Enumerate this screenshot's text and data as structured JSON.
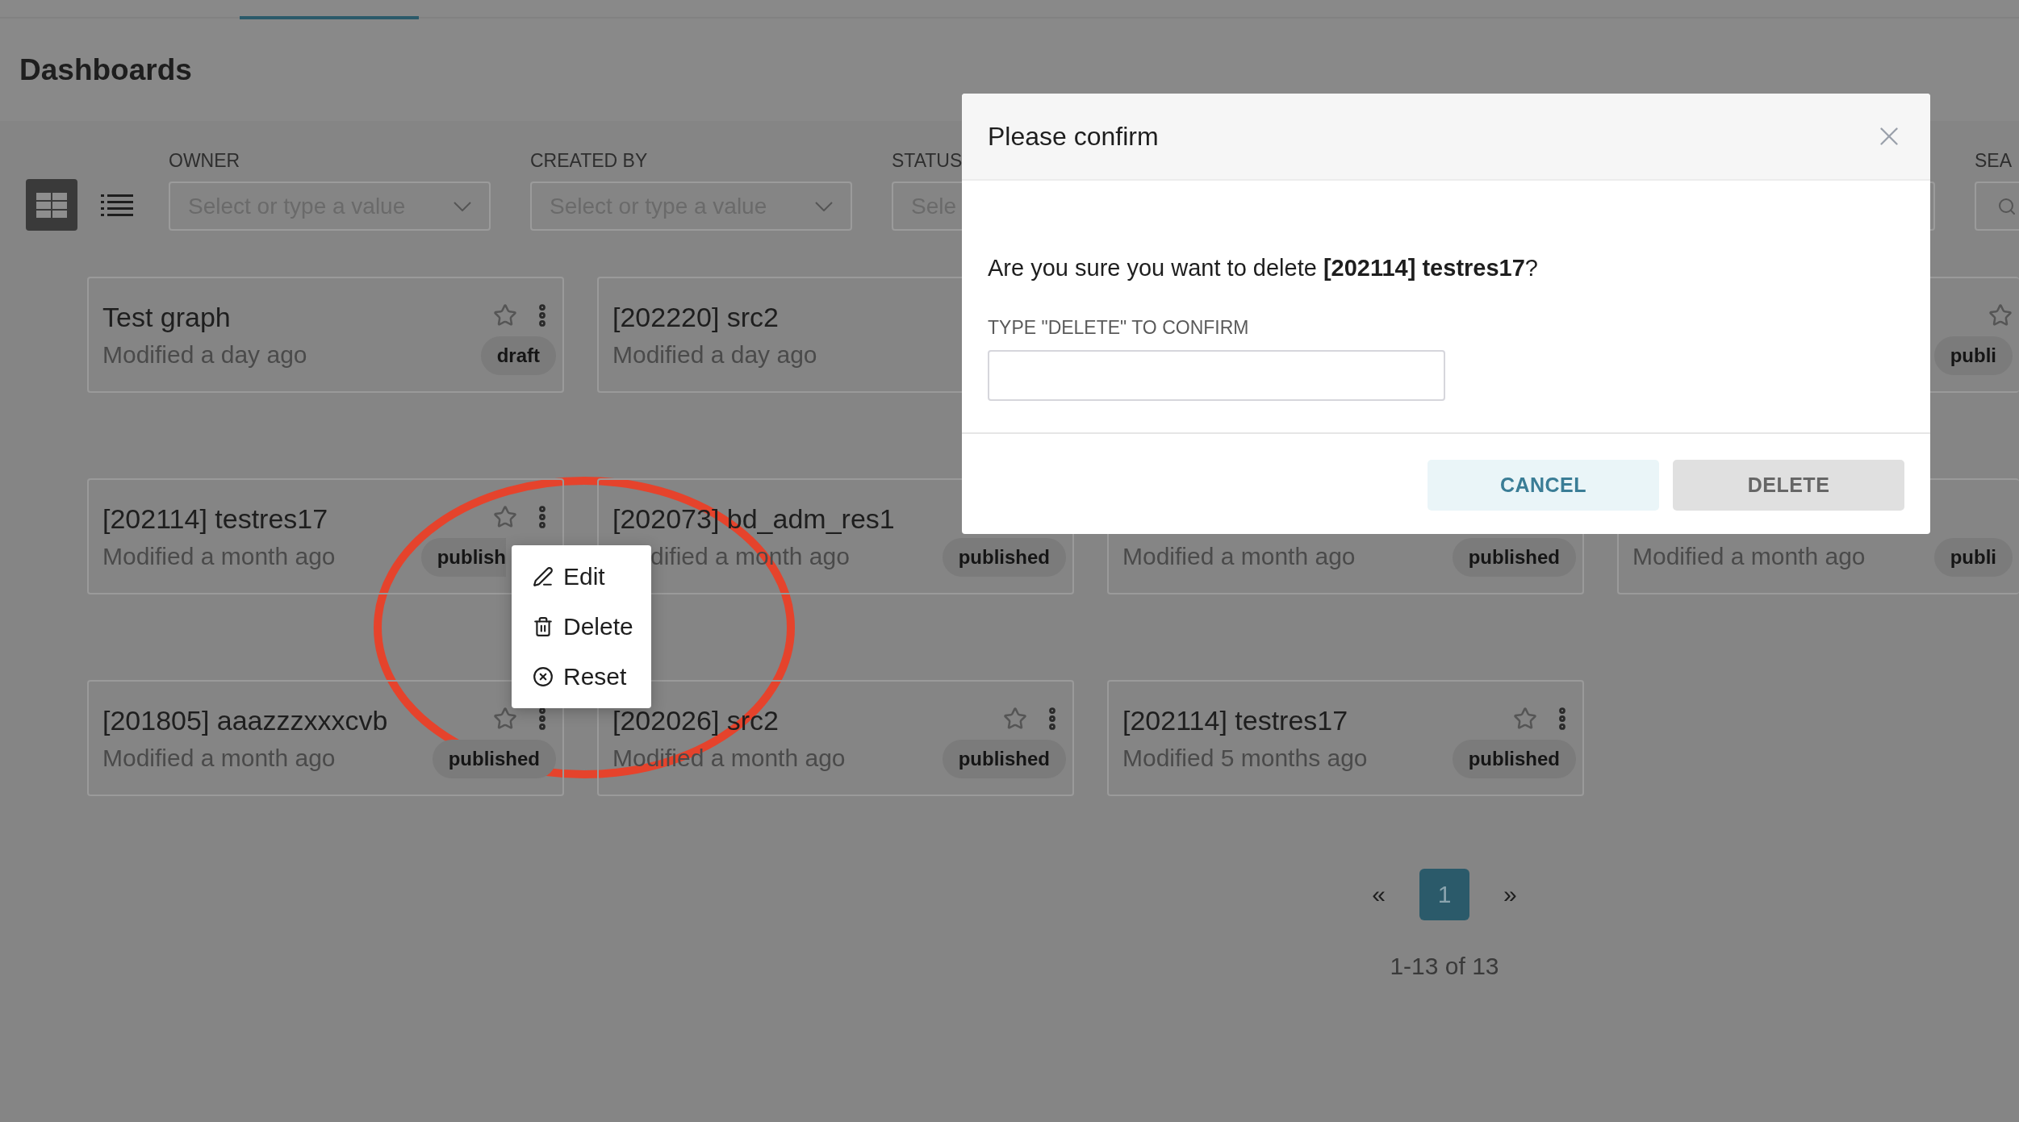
{
  "page": {
    "title": "Dashboards"
  },
  "views": [
    {
      "kind": "grid",
      "selected": true
    },
    {
      "kind": "list",
      "selected": false
    }
  ],
  "filters": [
    {
      "label": "OWNER",
      "placeholder": "Select or type a value",
      "kind": "select"
    },
    {
      "label": "CREATED BY",
      "placeholder": "Select or type a value",
      "kind": "select"
    },
    {
      "label": "STATUS",
      "placeholder": "Sele",
      "kind": "wide"
    }
  ],
  "search": {
    "label": "SEA"
  },
  "card_rows": [
    [
      {
        "kind": "full",
        "title": "Test graph",
        "subtitle": "Modified a day ago",
        "status": "draft"
      },
      {
        "kind": "plain",
        "title": "[202220] src2",
        "subtitle": "Modified a day ago"
      },
      {
        "kind": "blank"
      },
      {
        "kind": "edge",
        "status": "publi"
      }
    ],
    [
      {
        "kind": "menu-open",
        "title": "[202114] testres17",
        "subtitle": "Modified a month ago",
        "status": "publish"
      },
      {
        "kind": "under-menu",
        "title": "[202073] bd_adm_res1",
        "subtitle": "dified a month ago",
        "status": "published"
      },
      {
        "kind": "lower",
        "subtitle": "Modified a month ago",
        "status": "published"
      },
      {
        "kind": "lower",
        "subtitle": "Modified a month ago",
        "status": "publi"
      }
    ],
    [
      {
        "kind": "full",
        "title": "[201805] aaazzzxxxcvb",
        "subtitle": "Modified a month ago",
        "status": "published"
      },
      {
        "kind": "full",
        "title": "[202026] src2",
        "subtitle": "Modified a month ago",
        "status": "published"
      },
      {
        "kind": "full",
        "title": "[202114] testres17",
        "subtitle": "Modified 5 months ago",
        "status": "published"
      }
    ]
  ],
  "pagination": {
    "prev": "«",
    "pages": [
      {
        "label": "1",
        "selected": true
      }
    ],
    "next": "»",
    "summary": "1-13 of 13"
  },
  "context_menu": {
    "items": [
      {
        "kind": "edit",
        "label": "Edit"
      },
      {
        "kind": "delete",
        "label": "Delete"
      },
      {
        "kind": "reset",
        "label": "Reset"
      }
    ]
  },
  "dialog": {
    "title": "Please confirm",
    "message": "Are you sure you want to delete **[202114] testres17**?",
    "field_label": "TYPE \"DELETE\" TO CONFIRM",
    "buttons": [
      {
        "kind": "secondary",
        "label": "CANCEL"
      },
      {
        "kind": "primary",
        "label": "DELETE"
      }
    ]
  }
}
